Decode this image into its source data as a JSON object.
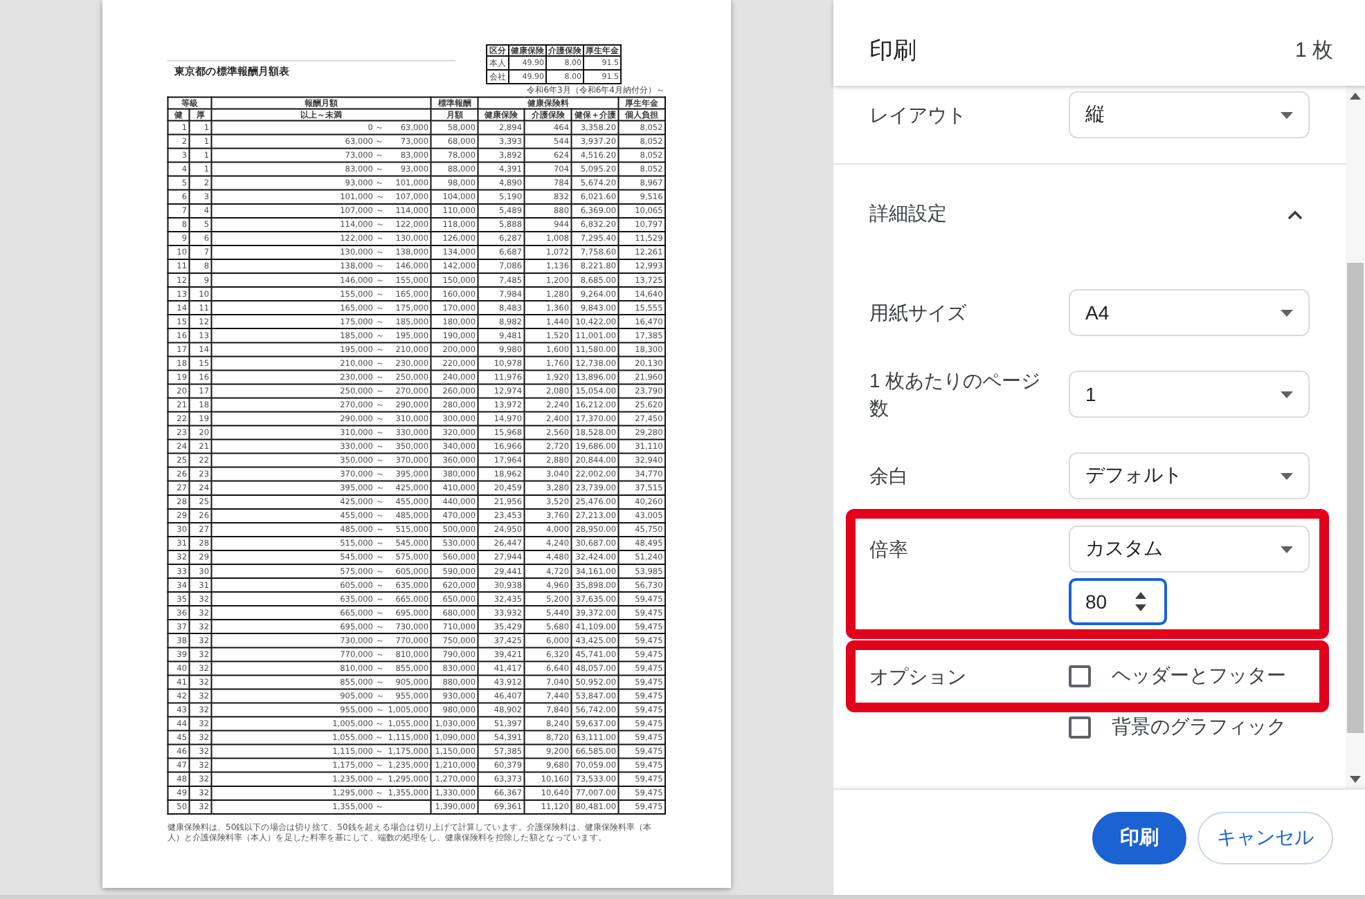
{
  "preview": {
    "page": {
      "title": "東京都の標準報酬月額表",
      "rate_table": {
        "columns": [
          "区分",
          "健康保険",
          "介護保険",
          "厚生年金"
        ],
        "rows": [
          [
            "本人",
            "49.90",
            "8.00",
            "91.5"
          ],
          [
            "会社",
            "49.90",
            "8.00",
            "91.5"
          ]
        ]
      },
      "effective_note": "令和6年3月（令和6年4月納付分）～",
      "table": {
        "column_groups": [
          {
            "label": "等級",
            "columns": [
              "健",
              "厚"
            ]
          },
          {
            "label": "報酬月額",
            "columns": [
              "以上～未満"
            ]
          },
          {
            "label": "標準報酬",
            "columns": [
              "月額"
            ]
          },
          {
            "label": "健康保険料",
            "columns": [
              "健康保険",
              "介護保険",
              "健保＋介護"
            ]
          },
          {
            "label": "厚生年金",
            "columns": [
              "個人負担"
            ]
          }
        ],
        "rows": [
          {
            "grade_health": "1",
            "grade_pension": "1",
            "from": "0 ～",
            "to": "63,000",
            "standard": "58,000",
            "health": "2,894",
            "care": "464",
            "health_care": "3,358.20",
            "pension": "8,052"
          },
          {
            "grade_health": "2",
            "grade_pension": "1",
            "from": "63,000 ～",
            "to": "73,000",
            "standard": "68,000",
            "health": "3,393",
            "care": "544",
            "health_care": "3,937.20",
            "pension": "8,052"
          },
          {
            "grade_health": "3",
            "grade_pension": "1",
            "from": "73,000 ～",
            "to": "83,000",
            "standard": "78,000",
            "health": "3,892",
            "care": "624",
            "health_care": "4,516.20",
            "pension": "8,052"
          },
          {
            "grade_health": "4",
            "grade_pension": "1",
            "from": "83,000 ～",
            "to": "93,000",
            "standard": "88,000",
            "health": "4,391",
            "care": "704",
            "health_care": "5,095.20",
            "pension": "8,052"
          },
          {
            "grade_health": "5",
            "grade_pension": "2",
            "from": "93,000 ～",
            "to": "101,000",
            "standard": "98,000",
            "health": "4,890",
            "care": "784",
            "health_care": "5,674.20",
            "pension": "8,967"
          },
          {
            "grade_health": "6",
            "grade_pension": "3",
            "from": "101,000 ～",
            "to": "107,000",
            "standard": "104,000",
            "health": "5,190",
            "care": "832",
            "health_care": "6,021.60",
            "pension": "9,516"
          },
          {
            "grade_health": "7",
            "grade_pension": "4",
            "from": "107,000 ～",
            "to": "114,000",
            "standard": "110,000",
            "health": "5,489",
            "care": "880",
            "health_care": "6,369.00",
            "pension": "10,065"
          },
          {
            "grade_health": "8",
            "grade_pension": "5",
            "from": "114,000 ～",
            "to": "122,000",
            "standard": "118,000",
            "health": "5,888",
            "care": "944",
            "health_care": "6,832.20",
            "pension": "10,797"
          },
          {
            "grade_health": "9",
            "grade_pension": "6",
            "from": "122,000 ～",
            "to": "130,000",
            "standard": "126,000",
            "health": "6,287",
            "care": "1,008",
            "health_care": "7,295.40",
            "pension": "11,529"
          },
          {
            "grade_health": "10",
            "grade_pension": "7",
            "from": "130,000 ～",
            "to": "138,000",
            "standard": "134,000",
            "health": "6,687",
            "care": "1,072",
            "health_care": "7,758.60",
            "pension": "12,261"
          },
          {
            "grade_health": "11",
            "grade_pension": "8",
            "from": "138,000 ～",
            "to": "146,000",
            "standard": "142,000",
            "health": "7,086",
            "care": "1,136",
            "health_care": "8,221.80",
            "pension": "12,993"
          },
          {
            "grade_health": "12",
            "grade_pension": "9",
            "from": "146,000 ～",
            "to": "155,000",
            "standard": "150,000",
            "health": "7,485",
            "care": "1,200",
            "health_care": "8,685.00",
            "pension": "13,725"
          },
          {
            "grade_health": "13",
            "grade_pension": "10",
            "from": "155,000 ～",
            "to": "165,000",
            "standard": "160,000",
            "health": "7,984",
            "care": "1,280",
            "health_care": "9,264.00",
            "pension": "14,640"
          },
          {
            "grade_health": "14",
            "grade_pension": "11",
            "from": "165,000 ～",
            "to": "175,000",
            "standard": "170,000",
            "health": "8,483",
            "care": "1,360",
            "health_care": "9,843.00",
            "pension": "15,555"
          },
          {
            "grade_health": "15",
            "grade_pension": "12",
            "from": "175,000 ～",
            "to": "185,000",
            "standard": "180,000",
            "health": "8,982",
            "care": "1,440",
            "health_care": "10,422.00",
            "pension": "16,470"
          },
          {
            "grade_health": "16",
            "grade_pension": "13",
            "from": "185,000 ～",
            "to": "195,000",
            "standard": "190,000",
            "health": "9,481",
            "care": "1,520",
            "health_care": "11,001.00",
            "pension": "17,385"
          },
          {
            "grade_health": "17",
            "grade_pension": "14",
            "from": "195,000 ～",
            "to": "210,000",
            "standard": "200,000",
            "health": "9,980",
            "care": "1,600",
            "health_care": "11,580.00",
            "pension": "18,300"
          },
          {
            "grade_health": "18",
            "grade_pension": "15",
            "from": "210,000 ～",
            "to": "230,000",
            "standard": "220,000",
            "health": "10,978",
            "care": "1,760",
            "health_care": "12,738.00",
            "pension": "20,130"
          },
          {
            "grade_health": "19",
            "grade_pension": "16",
            "from": "230,000 ～",
            "to": "250,000",
            "standard": "240,000",
            "health": "11,976",
            "care": "1,920",
            "health_care": "13,896.00",
            "pension": "21,960"
          },
          {
            "grade_health": "20",
            "grade_pension": "17",
            "from": "250,000 ～",
            "to": "270,000",
            "standard": "260,000",
            "health": "12,974",
            "care": "2,080",
            "health_care": "15,054.00",
            "pension": "23,790"
          },
          {
            "grade_health": "21",
            "grade_pension": "18",
            "from": "270,000 ～",
            "to": "290,000",
            "standard": "280,000",
            "health": "13,972",
            "care": "2,240",
            "health_care": "16,212.00",
            "pension": "25,620"
          },
          {
            "grade_health": "22",
            "grade_pension": "19",
            "from": "290,000 ～",
            "to": "310,000",
            "standard": "300,000",
            "health": "14,970",
            "care": "2,400",
            "health_care": "17,370.00",
            "pension": "27,450"
          },
          {
            "grade_health": "23",
            "grade_pension": "20",
            "from": "310,000 ～",
            "to": "330,000",
            "standard": "320,000",
            "health": "15,968",
            "care": "2,560",
            "health_care": "18,528.00",
            "pension": "29,280"
          },
          {
            "grade_health": "24",
            "grade_pension": "21",
            "from": "330,000 ～",
            "to": "350,000",
            "standard": "340,000",
            "health": "16,966",
            "care": "2,720",
            "health_care": "19,686.00",
            "pension": "31,110"
          },
          {
            "grade_health": "25",
            "grade_pension": "22",
            "from": "350,000 ～",
            "to": "370,000",
            "standard": "360,000",
            "health": "17,964",
            "care": "2,880",
            "health_care": "20,844.00",
            "pension": "32,940"
          },
          {
            "grade_health": "26",
            "grade_pension": "23",
            "from": "370,000 ～",
            "to": "395,000",
            "standard": "380,000",
            "health": "18,962",
            "care": "3,040",
            "health_care": "22,002.00",
            "pension": "34,770"
          },
          {
            "grade_health": "27",
            "grade_pension": "24",
            "from": "395,000 ～",
            "to": "425,000",
            "standard": "410,000",
            "health": "20,459",
            "care": "3,280",
            "health_care": "23,739.00",
            "pension": "37,515"
          },
          {
            "grade_health": "28",
            "grade_pension": "25",
            "from": "425,000 ～",
            "to": "455,000",
            "standard": "440,000",
            "health": "21,956",
            "care": "3,520",
            "health_care": "25,476.00",
            "pension": "40,260"
          },
          {
            "grade_health": "29",
            "grade_pension": "26",
            "from": "455,000 ～",
            "to": "485,000",
            "standard": "470,000",
            "health": "23,453",
            "care": "3,760",
            "health_care": "27,213.00",
            "pension": "43,005"
          },
          {
            "grade_health": "30",
            "grade_pension": "27",
            "from": "485,000 ～",
            "to": "515,000",
            "standard": "500,000",
            "health": "24,950",
            "care": "4,000",
            "health_care": "28,950.00",
            "pension": "45,750"
          },
          {
            "grade_health": "31",
            "grade_pension": "28",
            "from": "515,000 ～",
            "to": "545,000",
            "standard": "530,000",
            "health": "26,447",
            "care": "4,240",
            "health_care": "30,687.00",
            "pension": "48,495"
          },
          {
            "grade_health": "32",
            "grade_pension": "29",
            "from": "545,000 ～",
            "to": "575,000",
            "standard": "560,000",
            "health": "27,944",
            "care": "4,480",
            "health_care": "32,424.00",
            "pension": "51,240"
          },
          {
            "grade_health": "33",
            "grade_pension": "30",
            "from": "575,000 ～",
            "to": "605,000",
            "standard": "590,000",
            "health": "29,441",
            "care": "4,720",
            "health_care": "34,161.00",
            "pension": "53,985"
          },
          {
            "grade_health": "34",
            "grade_pension": "31",
            "from": "605,000 ～",
            "to": "635,000",
            "standard": "620,000",
            "health": "30,938",
            "care": "4,960",
            "health_care": "35,898.00",
            "pension": "56,730"
          },
          {
            "grade_health": "35",
            "grade_pension": "32",
            "from": "635,000 ～",
            "to": "665,000",
            "standard": "650,000",
            "health": "32,435",
            "care": "5,200",
            "health_care": "37,635.00",
            "pension": "59,475"
          },
          {
            "grade_health": "36",
            "grade_pension": "32",
            "from": "665,000 ～",
            "to": "695,000",
            "standard": "680,000",
            "health": "33,932",
            "care": "5,440",
            "health_care": "39,372.00",
            "pension": "59,475"
          },
          {
            "grade_health": "37",
            "grade_pension": "32",
            "from": "695,000 ～",
            "to": "730,000",
            "standard": "710,000",
            "health": "35,429",
            "care": "5,680",
            "health_care": "41,109.00",
            "pension": "59,475"
          },
          {
            "grade_health": "38",
            "grade_pension": "32",
            "from": "730,000 ～",
            "to": "770,000",
            "standard": "750,000",
            "health": "37,425",
            "care": "6,000",
            "health_care": "43,425.00",
            "pension": "59,475"
          },
          {
            "grade_health": "39",
            "grade_pension": "32",
            "from": "770,000 ～",
            "to": "810,000",
            "standard": "790,000",
            "health": "39,421",
            "care": "6,320",
            "health_care": "45,741.00",
            "pension": "59,475"
          },
          {
            "grade_health": "40",
            "grade_pension": "32",
            "from": "810,000 ～",
            "to": "855,000",
            "standard": "830,000",
            "health": "41,417",
            "care": "6,640",
            "health_care": "48,057.00",
            "pension": "59,475"
          },
          {
            "grade_health": "41",
            "grade_pension": "32",
            "from": "855,000 ～",
            "to": "905,000",
            "standard": "880,000",
            "health": "43,912",
            "care": "7,040",
            "health_care": "50,952.00",
            "pension": "59,475"
          },
          {
            "grade_health": "42",
            "grade_pension": "32",
            "from": "905,000 ～",
            "to": "955,000",
            "standard": "930,000",
            "health": "46,407",
            "care": "7,440",
            "health_care": "53,847.00",
            "pension": "59,475"
          },
          {
            "grade_health": "43",
            "grade_pension": "32",
            "from": "955,000 ～",
            "to": "1,005,000",
            "standard": "980,000",
            "health": "48,902",
            "care": "7,840",
            "health_care": "56,742.00",
            "pension": "59,475"
          },
          {
            "grade_health": "44",
            "grade_pension": "32",
            "from": "1,005,000 ～",
            "to": "1,055,000",
            "standard": "1,030,000",
            "health": "51,397",
            "care": "8,240",
            "health_care": "59,637.00",
            "pension": "59,475"
          },
          {
            "grade_health": "45",
            "grade_pension": "32",
            "from": "1,055,000 ～",
            "to": "1,115,000",
            "standard": "1,090,000",
            "health": "54,391",
            "care": "8,720",
            "health_care": "63,111.00",
            "pension": "59,475"
          },
          {
            "grade_health": "46",
            "grade_pension": "32",
            "from": "1,115,000 ～",
            "to": "1,175,000",
            "standard": "1,150,000",
            "health": "57,385",
            "care": "9,200",
            "health_care": "66,585.00",
            "pension": "59,475"
          },
          {
            "grade_health": "47",
            "grade_pension": "32",
            "from": "1,175,000 ～",
            "to": "1,235,000",
            "standard": "1,210,000",
            "health": "60,379",
            "care": "9,680",
            "health_care": "70,059.00",
            "pension": "59,475"
          },
          {
            "grade_health": "48",
            "grade_pension": "32",
            "from": "1,235,000 ～",
            "to": "1,295,000",
            "standard": "1,270,000",
            "health": "63,373",
            "care": "10,160",
            "health_care": "73,533.00",
            "pension": "59,475"
          },
          {
            "grade_health": "49",
            "grade_pension": "32",
            "from": "1,295,000 ～",
            "to": "1,355,000",
            "standard": "1,330,000",
            "health": "66,367",
            "care": "10,640",
            "health_care": "77,007.00",
            "pension": "59,475"
          },
          {
            "grade_health": "50",
            "grade_pension": "32",
            "from": "1,355,000 ～",
            "standard": "1,390,000",
            "health": "69,361",
            "care": "11,120",
            "health_care": "80,481.00",
            "pension": "59,475"
          }
        ]
      },
      "footnote": "健康保険料は、50銭以下の場合は切り捨て、50銭を超える場合は切り上げて計算しています。介護保険料は、健康保険料率（本人）と介護保険料率（本人）を足した料率を基にして、端数の処理をし、健康保険料を控除した額となっています。"
    }
  },
  "print_panel": {
    "title": "印刷",
    "sheet_count": "1 枚",
    "settings": [
      {
        "kind": "select",
        "label": "レイアウト",
        "value": "縦",
        "highlighted": false
      },
      {
        "kind": "section",
        "label": "詳細設定",
        "expanded": true
      },
      {
        "kind": "select",
        "label": "用紙サイズ",
        "value": "A4",
        "highlighted": false
      },
      {
        "kind": "select",
        "label": "1 枚あたりのページ数",
        "value": "1",
        "highlighted": false
      },
      {
        "kind": "select",
        "label": "余白",
        "value": "デフォルト",
        "highlighted": false
      },
      {
        "kind": "select",
        "label": "倍率",
        "value": "カスタム",
        "custom_value": "80",
        "highlighted": true
      },
      {
        "kind": "checkbox",
        "label": "オプション",
        "option": "ヘッダーとフッター",
        "checked": false,
        "highlighted": true
      },
      {
        "kind": "checkbox",
        "option": "背景のグラフィック",
        "checked": false,
        "highlighted": false
      }
    ],
    "buttons": [
      {
        "label": "印刷",
        "primary": true
      },
      {
        "label": "キャンセル",
        "primary": false
      }
    ]
  }
}
